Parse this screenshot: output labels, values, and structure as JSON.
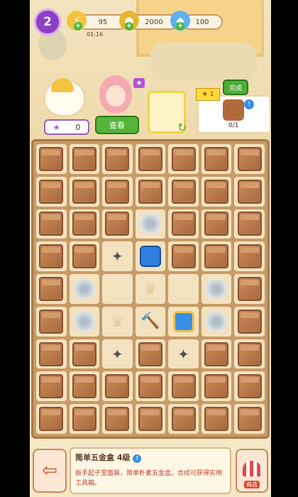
{
  "top_bar": {
    "level": "2",
    "energy": "95",
    "energy_timer": "01:16",
    "coins": "2000",
    "gems": "100"
  },
  "character_panel": {
    "star_count": "0",
    "view_button": "查看"
  },
  "quest": {
    "star_reward": "1",
    "done_button": "完成",
    "progress": "0/1"
  },
  "board": {
    "rows": [
      [
        "box",
        "box",
        "box",
        "box",
        "box",
        "box",
        "box"
      ],
      [
        "box",
        "box",
        "box",
        "box",
        "box",
        "box",
        "box"
      ],
      [
        "box",
        "box",
        "box",
        "web",
        "box",
        "box",
        "box"
      ],
      [
        "box",
        "box",
        "tool-web",
        "bag",
        "box-web",
        "box",
        "box"
      ],
      [
        "box",
        "web",
        "empty",
        "crown",
        "empty",
        "web",
        "box"
      ],
      [
        "box",
        "web",
        "crown",
        "hammer",
        "toolbox",
        "web",
        "box"
      ],
      [
        "box",
        "box",
        "tool-web",
        "box-web",
        "tool-web",
        "box",
        "box"
      ],
      [
        "box",
        "box",
        "box",
        "box",
        "box",
        "box",
        "box"
      ],
      [
        "box",
        "box",
        "box",
        "box",
        "box",
        "box",
        "box"
      ]
    ]
  },
  "item_info": {
    "title": "简单五金盒 4级",
    "description": "扳手起子里面装，简单朴素五金盒。合成可获得实用工具箱。"
  },
  "bottom_bar": {
    "shop_label": "商店"
  },
  "colors": {
    "accent_green": "#55b33a",
    "level_purple": "#8b3fc7",
    "board_brown": "#c89a66"
  }
}
